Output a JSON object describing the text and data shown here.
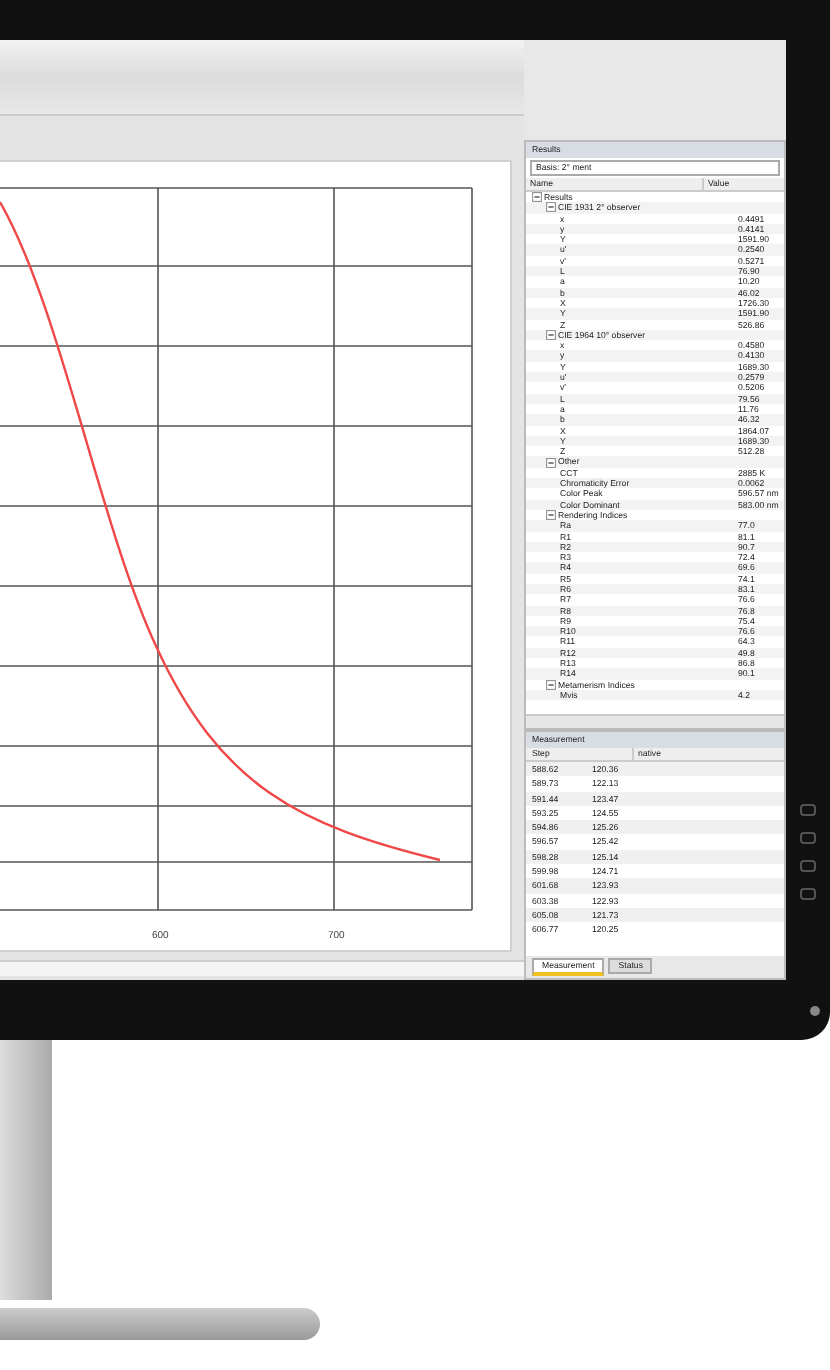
{
  "chart": {
    "x_tick_labels": [
      "600",
      "700"
    ]
  },
  "results_panel": {
    "title": "Results",
    "basis": "Basis: 2° ment",
    "columns": [
      "Name",
      "Value"
    ],
    "tree": [
      {
        "name": "Results",
        "expanded": true,
        "children": [
          {
            "name": "CIE 1931 2° observer",
            "expanded": true,
            "children": [
              {
                "name": "x",
                "value": "0.4491"
              },
              {
                "name": "y",
                "value": "0.4141"
              },
              {
                "name": "Y",
                "value": "1591.90"
              },
              {
                "name": "u'",
                "value": "0.2540"
              },
              {
                "name": "v'",
                "value": "0.5271"
              },
              {
                "name": "L",
                "value": "76.90"
              },
              {
                "name": "a",
                "value": "10.20"
              },
              {
                "name": "b",
                "value": "46.02"
              },
              {
                "name": "X",
                "value": "1726.30"
              },
              {
                "name": "Y",
                "value": "1591.90"
              },
              {
                "name": "Z",
                "value": "526.86"
              }
            ]
          },
          {
            "name": "CIE 1964 10° observer",
            "expanded": true,
            "children": [
              {
                "name": "x",
                "value": "0.4580"
              },
              {
                "name": "y",
                "value": "0.4130"
              },
              {
                "name": "Y",
                "value": "1689.30"
              },
              {
                "name": "u'",
                "value": "0.2579"
              },
              {
                "name": "v'",
                "value": "0.5206"
              },
              {
                "name": "L",
                "value": "79.56"
              },
              {
                "name": "a",
                "value": "11.76"
              },
              {
                "name": "b",
                "value": "46.32"
              },
              {
                "name": "X",
                "value": "1864.07"
              },
              {
                "name": "Y",
                "value": "1689.30"
              },
              {
                "name": "Z",
                "value": "512.28"
              }
            ]
          },
          {
            "name": "Other",
            "expanded": true,
            "children": [
              {
                "name": "CCT",
                "value": "2885 K"
              },
              {
                "name": "Chromaticity Error",
                "value": "0.0062"
              },
              {
                "name": "Color Peak",
                "value": "596.57 nm"
              },
              {
                "name": "Color Dominant",
                "value": "583.00 nm"
              }
            ]
          },
          {
            "name": "Rendering Indices",
            "expanded": true,
            "children": [
              {
                "name": "Ra",
                "value": "77.0"
              },
              {
                "name": "R1",
                "value": "81.1"
              },
              {
                "name": "R2",
                "value": "90.7"
              },
              {
                "name": "R3",
                "value": "72.4"
              },
              {
                "name": "R4",
                "value": "69.6"
              },
              {
                "name": "R5",
                "value": "74.1"
              },
              {
                "name": "R6",
                "value": "83.1"
              },
              {
                "name": "R7",
                "value": "76.6"
              },
              {
                "name": "R8",
                "value": "76.8"
              },
              {
                "name": "R9",
                "value": "75.4"
              },
              {
                "name": "R10",
                "value": "76.6"
              },
              {
                "name": "R11",
                "value": "64.3"
              },
              {
                "name": "R12",
                "value": "49.8"
              },
              {
                "name": "R13",
                "value": "86.8"
              },
              {
                "name": "R14",
                "value": "90.1"
              }
            ]
          },
          {
            "name": "Metamerism Indices",
            "expanded": true,
            "children": [
              {
                "name": "Mvis",
                "value": "4.2"
              }
            ]
          }
        ]
      }
    ]
  },
  "measurement_panel": {
    "title": "Measurement",
    "columns": [
      "Step",
      "native"
    ],
    "rows": [
      [
        "588.62",
        "120.36"
      ],
      [
        "589.73",
        "122.13"
      ],
      [
        "591.44",
        "123.47"
      ],
      [
        "593.25",
        "124.55"
      ],
      [
        "594.86",
        "125.26"
      ],
      [
        "596.57",
        "125.42"
      ],
      [
        "598.28",
        "125.14"
      ],
      [
        "599.98",
        "124.71"
      ],
      [
        "601.68",
        "123.93"
      ],
      [
        "603.38",
        "122.93"
      ],
      [
        "605.08",
        "121.73"
      ],
      [
        "606.77",
        "120.25"
      ]
    ]
  },
  "tabs": [
    {
      "label": "Measurement",
      "selected": true
    },
    {
      "label": "Status",
      "selected": false
    }
  ]
}
